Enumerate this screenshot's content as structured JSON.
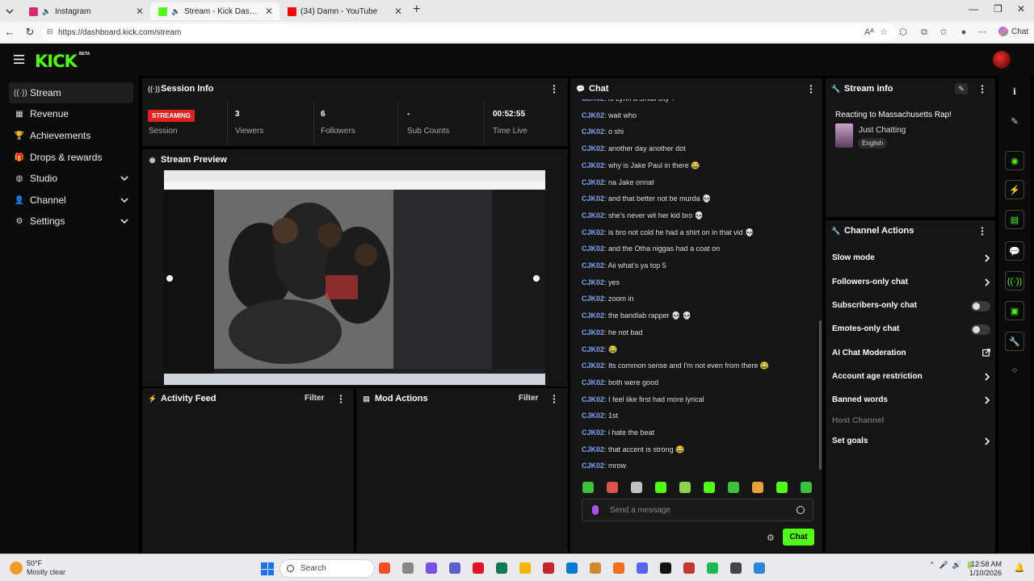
{
  "browser": {
    "tabs": [
      {
        "title": "Instagram",
        "favicon_color": "#d62976",
        "muted": true,
        "active": false
      },
      {
        "title": "Stream - Kick Dashboard",
        "favicon_color": "#53fc18",
        "muted": true,
        "active": true
      },
      {
        "title": "(34) Damn - YouTube",
        "favicon_color": "#ff0000",
        "muted": false,
        "active": false
      }
    ],
    "url": "https://dashboard.kick.com/stream",
    "copilot_label": "Chat"
  },
  "header": {
    "logo": "KICK",
    "beta": "BETA"
  },
  "sidebar": {
    "items": [
      {
        "label": "Stream",
        "icon": "broadcast-icon",
        "glyph": "((·))",
        "active": true,
        "expandable": false
      },
      {
        "label": "Revenue",
        "icon": "revenue-icon",
        "glyph": "▦",
        "active": false,
        "expandable": false
      },
      {
        "label": "Achievements",
        "icon": "trophy-icon",
        "glyph": "🏆",
        "active": false,
        "expandable": false
      },
      {
        "label": "Drops & rewards",
        "icon": "gift-icon",
        "glyph": "🎁",
        "active": false,
        "expandable": false
      },
      {
        "label": "Studio",
        "icon": "studio-icon",
        "glyph": "◍",
        "active": false,
        "expandable": true
      },
      {
        "label": "Channel",
        "icon": "channel-icon",
        "glyph": "👤",
        "active": false,
        "expandable": true
      },
      {
        "label": "Settings",
        "icon": "gear-icon",
        "glyph": "⚙",
        "active": false,
        "expandable": true
      }
    ]
  },
  "session": {
    "title": "Session Info",
    "status": "STREAMING",
    "status_label": "Session",
    "stats": [
      {
        "value": "3",
        "label": "Viewers"
      },
      {
        "value": "6",
        "label": "Followers"
      },
      {
        "value": "-",
        "label": "Sub Counts"
      },
      {
        "value": "00:52:55",
        "label": "Time Live"
      }
    ]
  },
  "preview": {
    "title": "Stream Preview"
  },
  "activity": {
    "title": "Activity Feed",
    "filter": "Filter"
  },
  "mod": {
    "title": "Mod Actions",
    "filter": "Filter"
  },
  "chat": {
    "title": "Chat",
    "messages": [
      {
        "user": "CJK02",
        "text": "is Lynn a small city ?"
      },
      {
        "user": "CJK02",
        "text": "wait who"
      },
      {
        "user": "CJK02",
        "text": "o shi"
      },
      {
        "user": "CJK02",
        "text": "another day another dot"
      },
      {
        "user": "CJK02",
        "text": "why is Jake Paul in there 😂"
      },
      {
        "user": "CJK02",
        "text": "na Jake onnat"
      },
      {
        "user": "CJK02",
        "text": "and that better not be murda 💀"
      },
      {
        "user": "CJK02",
        "text": "she's never wit her kid bro 💀"
      },
      {
        "user": "CJK02",
        "text": "is bro not cold he had a shirt on in that vid 💀"
      },
      {
        "user": "CJK02",
        "text": "and the Otha niggas had a coat on"
      },
      {
        "user": "CJK02",
        "text": "Aii what's ya top 5"
      },
      {
        "user": "CJK02",
        "text": "yes"
      },
      {
        "user": "CJK02",
        "text": "zoom in"
      },
      {
        "user": "CJK02",
        "text": "the bandlab rapper 💀 💀"
      },
      {
        "user": "CJK02",
        "text": "he not bad"
      },
      {
        "user": "CJK02",
        "text": "😂"
      },
      {
        "user": "CJK02",
        "text": "Its common sense and I'm not even from there 😂"
      },
      {
        "user": "CJK02",
        "text": "both were good"
      },
      {
        "user": "CJK02",
        "text": "I feel like first had more lyrical"
      },
      {
        "user": "CJK02",
        "text": "1st"
      },
      {
        "user": "CJK02",
        "text": "i hate the beat"
      },
      {
        "user": "CJK02",
        "text": "that accent is strong 😂"
      },
      {
        "user": "CJK02",
        "text": "mrow"
      }
    ],
    "emote_colors": [
      "#3fbf3f",
      "#d9534f",
      "#c0c0c0",
      "#53fc18",
      "#8fd14f",
      "#53fc18",
      "#3fbf3f",
      "#e8a03a",
      "#53fc18",
      "#3fbf3f"
    ],
    "placeholder": "Send a message",
    "send_label": "Chat"
  },
  "stream_info": {
    "title": "Stream info",
    "stream_title": "Reacting to Massachusetts Rap!",
    "category": "Just Chatting",
    "language": "English"
  },
  "channel_actions": {
    "title": "Channel Actions",
    "items": [
      {
        "label": "Slow mode",
        "control": "chevron"
      },
      {
        "label": "Followers-only chat",
        "control": "chevron"
      },
      {
        "label": "Subscribers-only chat",
        "control": "toggle"
      },
      {
        "label": "Emotes-only chat",
        "control": "toggle"
      },
      {
        "label": "AI Chat Moderation",
        "control": "external"
      },
      {
        "label": "Account age restriction",
        "control": "chevron"
      },
      {
        "label": "Banned words",
        "control": "chevron"
      },
      {
        "label": "Host Channel",
        "control": "disabled"
      },
      {
        "label": "Set goals",
        "control": "chevron"
      }
    ]
  },
  "rail": {
    "items": [
      {
        "name": "info-icon",
        "glyph": "ℹ"
      },
      {
        "name": "edit-icon",
        "glyph": "✎"
      },
      {
        "name": "camera-icon",
        "glyph": "◉"
      },
      {
        "name": "bolt-icon",
        "glyph": "⚡"
      },
      {
        "name": "document-icon",
        "glyph": "▤"
      },
      {
        "name": "chat-bubble-icon",
        "glyph": "💬"
      },
      {
        "name": "broadcast-icon",
        "glyph": "((·))"
      },
      {
        "name": "layout-icon",
        "glyph": "▣"
      },
      {
        "name": "wrench-icon",
        "glyph": "🔧"
      },
      {
        "name": "nodes-icon",
        "glyph": "⁘"
      }
    ]
  },
  "taskbar": {
    "weather_temp": "50°F",
    "weather_desc": "Mostly clear",
    "search": "Search",
    "time": "12:58 AM",
    "date": "1/10/2026",
    "app_colors": [
      "#f25022",
      "#888888",
      "#7b4fe0",
      "#5b5fc7",
      "#e81123",
      "#0f7b4f",
      "#f4b400",
      "#c4262e",
      "#0078d4",
      "#d08b2c",
      "#f37021",
      "#5865f2",
      "#111111",
      "#c0392b",
      "#1db954",
      "#444444",
      "#2b88d8"
    ]
  }
}
